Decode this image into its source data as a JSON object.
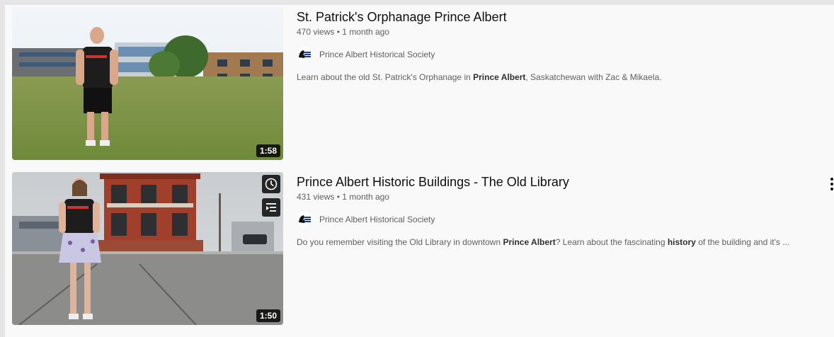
{
  "videos": [
    {
      "title": "St. Patrick's Orphanage Prince Albert",
      "views": "470 views",
      "separator": "•",
      "age": "1 month ago",
      "duration": "1:58",
      "channel": "Prince Albert Historical Society",
      "description": [
        {
          "text": "Learn about the old St. Patrick's Orphanage in ",
          "bold": false
        },
        {
          "text": "Prince Albert",
          "bold": true
        },
        {
          "text": ", Saskatchewan with Zac & Mikaela.",
          "bold": false
        }
      ]
    },
    {
      "title": "Prince Albert Historic Buildings - The Old Library",
      "views": "431 views",
      "separator": "•",
      "age": "1 month ago",
      "duration": "1:50",
      "channel": "Prince Albert Historical Society",
      "description": [
        {
          "text": "Do you remember visiting the Old Library in downtown ",
          "bold": false
        },
        {
          "text": "Prince Albert",
          "bold": true
        },
        {
          "text": "? Learn about the fascinating ",
          "bold": false
        },
        {
          "text": "history",
          "bold": true
        },
        {
          "text": " of the building and it's ...",
          "bold": false
        }
      ],
      "hover_actions": [
        "watch-later-icon",
        "add-to-queue-icon"
      ]
    }
  ],
  "colors": {
    "background": "#e6e6e6",
    "panel": "#f9f9f9",
    "secondary_text": "#606060",
    "duration_badge": "#000000"
  }
}
